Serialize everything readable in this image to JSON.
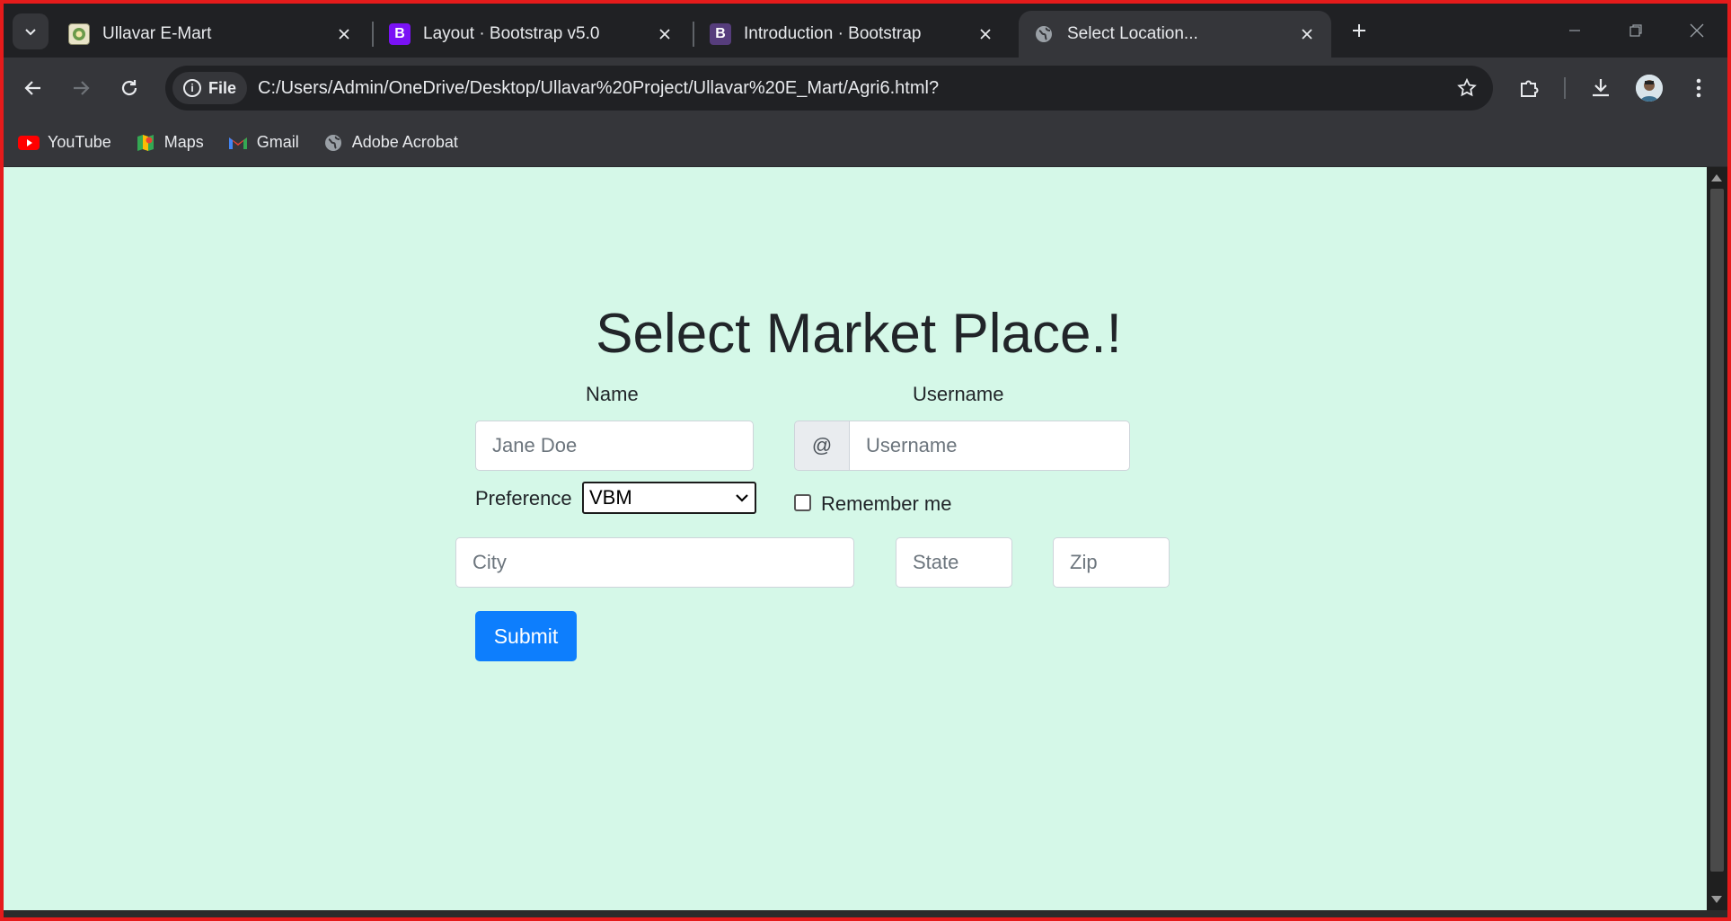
{
  "browser": {
    "tabs": [
      {
        "title": "Ullavar E-Mart",
        "favicon": "emblem-icon",
        "active": false
      },
      {
        "title": "Layout · Bootstrap v5.0",
        "favicon": "bootstrap-icon",
        "active": false
      },
      {
        "title": "Introduction · Bootstrap",
        "favicon": "bootstrap-icon",
        "active": false
      },
      {
        "title": "Select Location...",
        "favicon": "globe-icon",
        "active": true
      }
    ],
    "omnibox": {
      "chip_label": "File",
      "url": "C:/Users/Admin/OneDrive/Desktop/Ullavar%20Project/Ullavar%20E_Mart/Agri6.html?"
    },
    "bookmarks": [
      {
        "label": "YouTube",
        "icon": "youtube-icon"
      },
      {
        "label": "Maps",
        "icon": "maps-icon"
      },
      {
        "label": "Gmail",
        "icon": "gmail-icon"
      },
      {
        "label": "Adobe Acrobat",
        "icon": "globe-icon"
      }
    ]
  },
  "page": {
    "heading": "Select Market Place.!",
    "name_label": "Name",
    "name_placeholder": "Jane Doe",
    "username_label": "Username",
    "username_addon": "@",
    "username_placeholder": "Username",
    "preference_label": "Preference",
    "preference_value": "VBM",
    "remember_label": "Remember me",
    "city_placeholder": "City",
    "state_placeholder": "State",
    "zip_placeholder": "Zip",
    "submit_label": "Submit",
    "colors": {
      "background": "#d5f8e8",
      "primary_button": "#0d7efd",
      "frame_border": "#e51b1b"
    }
  }
}
